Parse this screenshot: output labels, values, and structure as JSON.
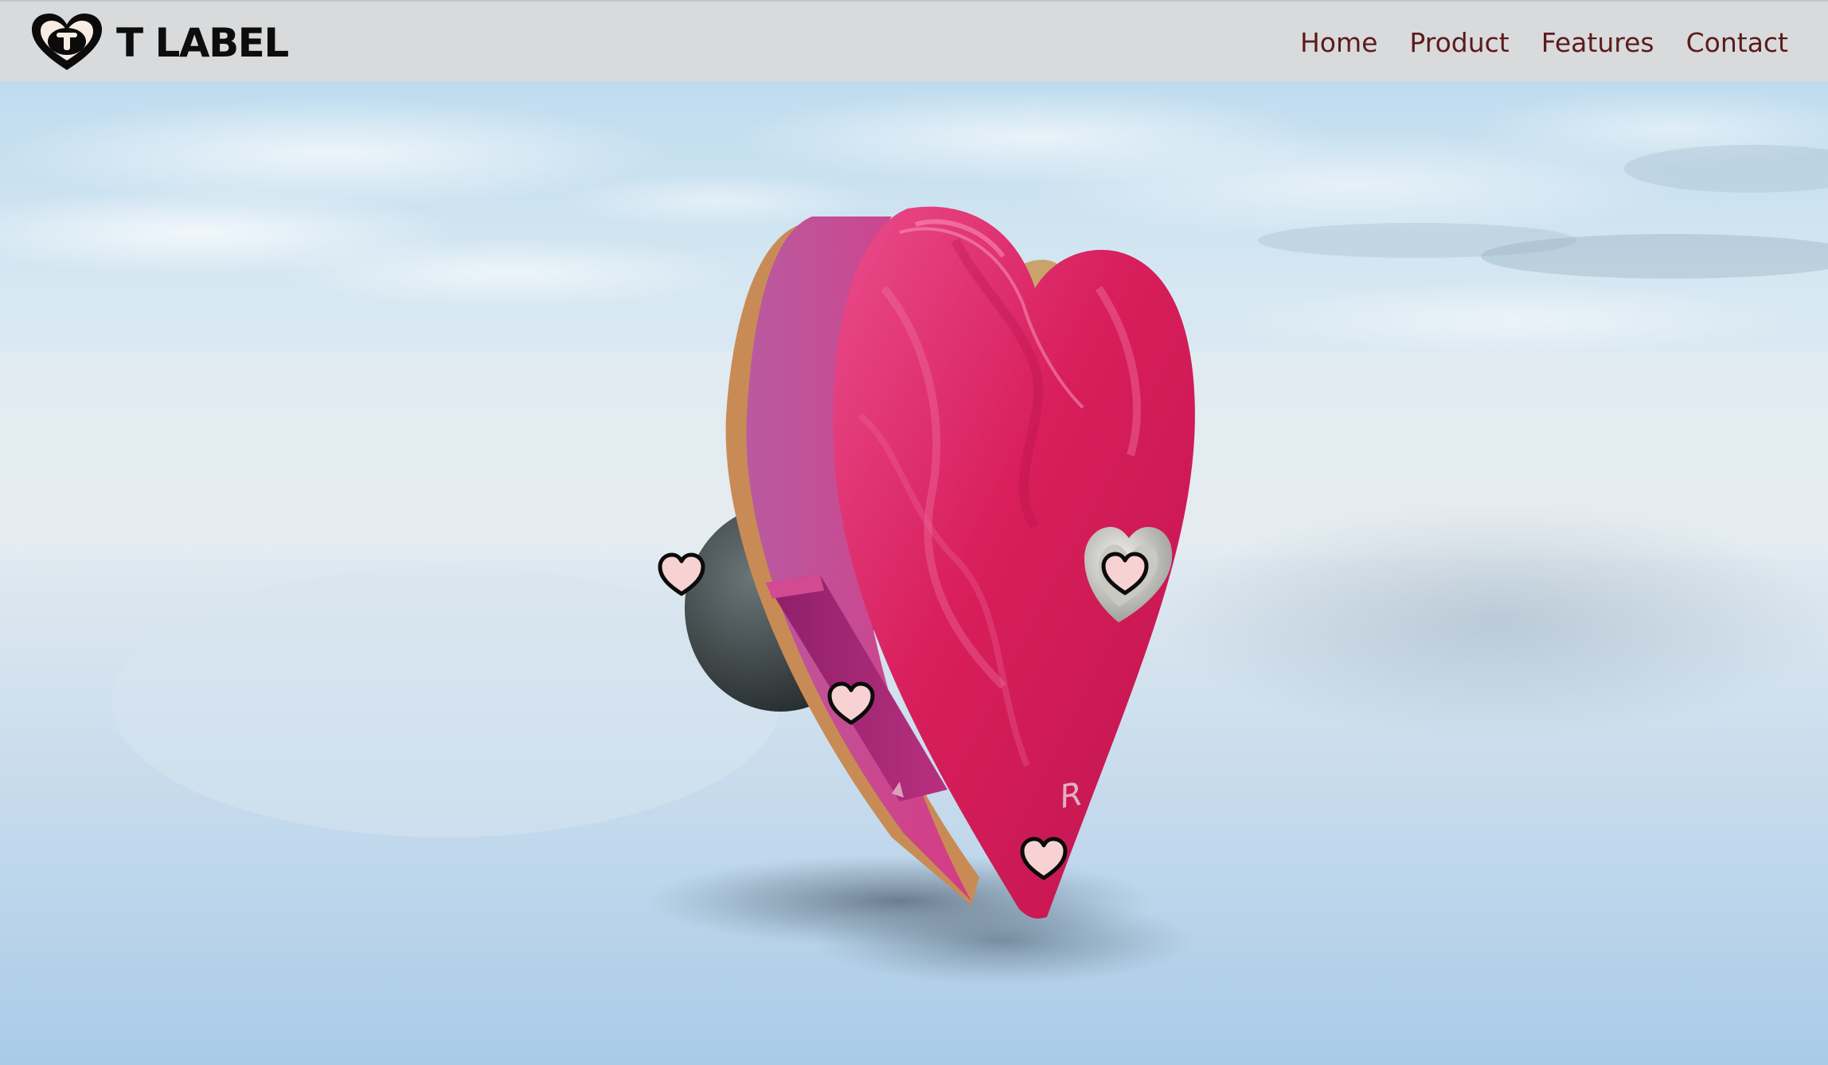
{
  "nav": {
    "brand_name": "T LABEL",
    "links": [
      {
        "label": "Home"
      },
      {
        "label": "Product"
      },
      {
        "label": "Features"
      },
      {
        "label": "Contact"
      }
    ]
  },
  "model": {
    "engraving": "R"
  },
  "colors": {
    "nav_bg": "#d9dadc",
    "nav_link": "#5b1b1b",
    "heart_body": "#d81e5b",
    "hotspot_fill": "#f8d2d2"
  },
  "icons": [
    "brand-heart-logo-icon",
    "heart-hotspot-icon"
  ]
}
